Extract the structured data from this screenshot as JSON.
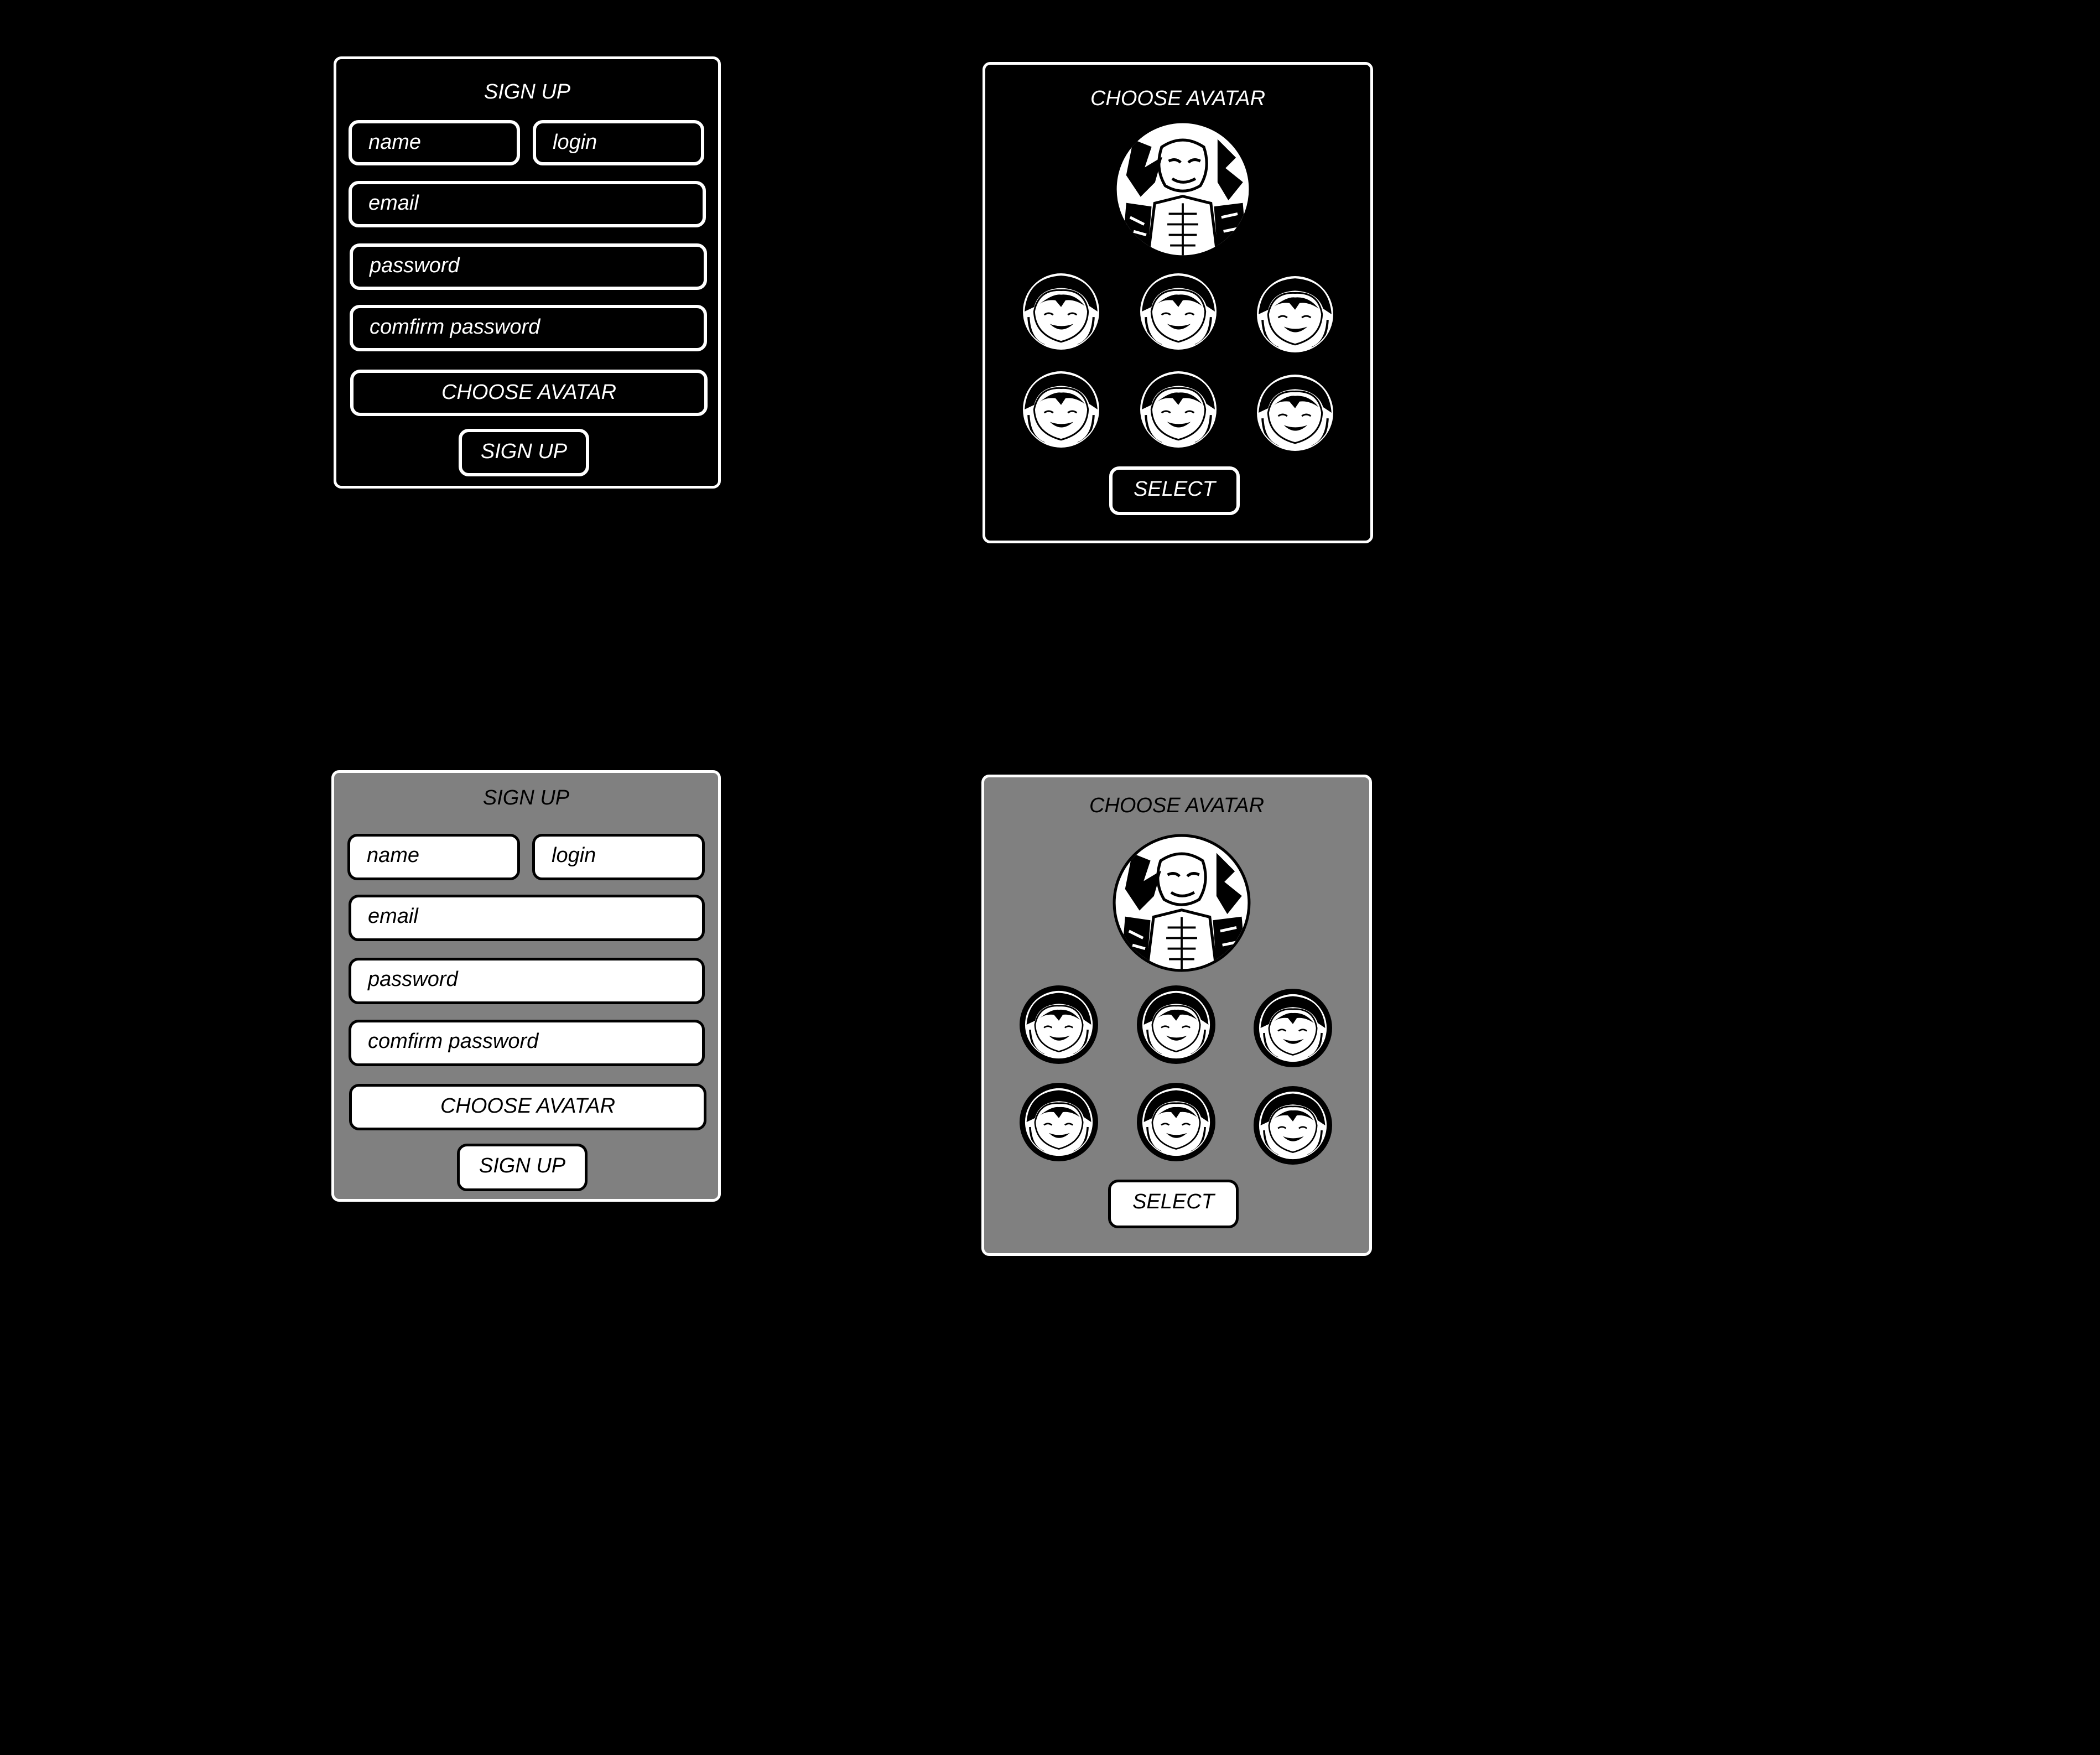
{
  "signup_form": {
    "title": "SIGN UP",
    "name_placeholder": "name",
    "login_placeholder": "login",
    "email_placeholder": "email",
    "password_placeholder": "password",
    "confirm_password_placeholder": "comfirm password",
    "choose_avatar_label": "CHOOSE AVATAR",
    "submit_label": "SIGN UP"
  },
  "avatar_picker": {
    "title": "CHOOSE AVATAR",
    "select_label": "SELECT",
    "large_avatar_icon": "character-portrait-icon",
    "option_icon": "girl-face-icon"
  },
  "colors": {
    "background": "#000000",
    "light_panel": "#808080",
    "outline": "#ffffff"
  }
}
